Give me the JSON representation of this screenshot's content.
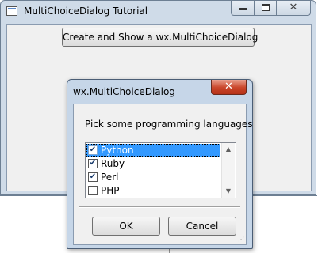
{
  "main_window": {
    "title": "MultiChoiceDialog Tutorial",
    "close_glyph": "✕",
    "button_label": "Create and Show a wx.MultiChoiceDialog"
  },
  "dialog": {
    "title": "wx.MultiChoiceDialog",
    "close_glyph": "✕",
    "prompt": "Pick some programming languages",
    "items": [
      {
        "label": "Python",
        "checked": true,
        "selected": true
      },
      {
        "label": "Ruby",
        "checked": true,
        "selected": false
      },
      {
        "label": "Perl",
        "checked": true,
        "selected": false
      },
      {
        "label": "PHP",
        "checked": false,
        "selected": false
      }
    ],
    "scroll_up_glyph": "▲",
    "scroll_down_glyph": "▼",
    "ok_label": "OK",
    "cancel_label": "Cancel",
    "resize_grip_glyph": "⋰"
  }
}
